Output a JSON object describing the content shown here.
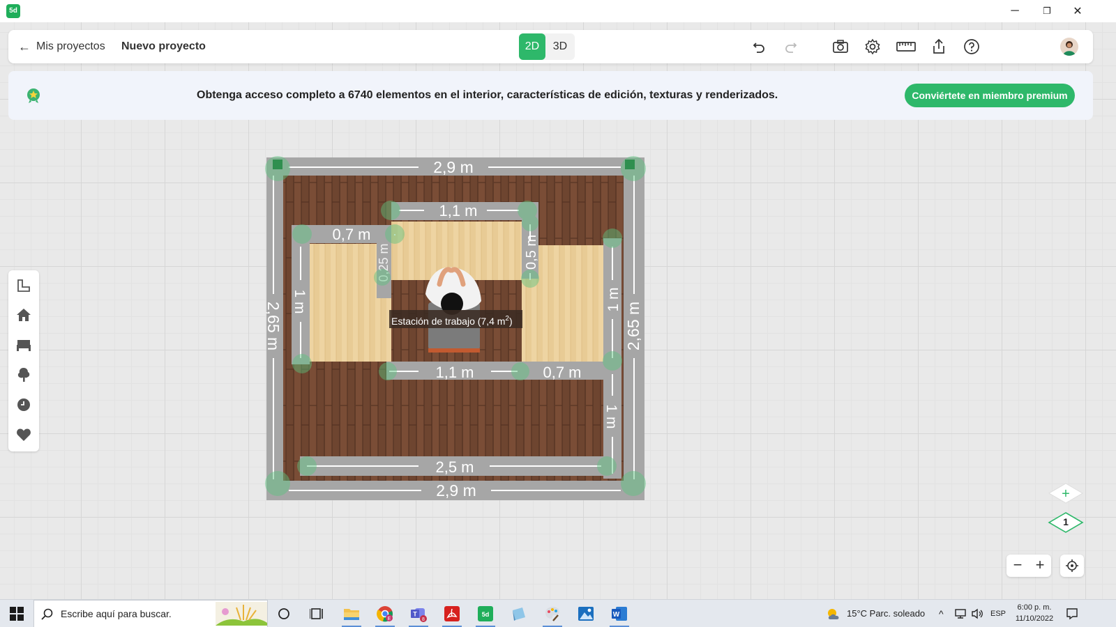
{
  "window": {
    "app_icon_label": "5d",
    "controls": {
      "minimize": "─",
      "restore": "❐",
      "close": "✕"
    }
  },
  "toolbar": {
    "back_label": "Mis proyectos",
    "project_title": "Nuevo proyecto",
    "mode_2d": "2D",
    "mode_3d": "3D",
    "active_mode": "2D",
    "icons": [
      "undo-icon",
      "redo-icon",
      "camera-icon",
      "settings-icon",
      "ruler-icon",
      "share-icon",
      "help-icon"
    ]
  },
  "banner": {
    "text": "Obtenga acceso completo a 6740 elementos en el interior, características de edición, texturas y renderizados.",
    "button_label": "Conviértete en miembro premium"
  },
  "sidebar": {
    "items": [
      {
        "icon": "rooms-icon"
      },
      {
        "icon": "house-icon"
      },
      {
        "icon": "furniture-icon"
      },
      {
        "icon": "tree-icon"
      },
      {
        "icon": "clock-icon"
      },
      {
        "icon": "heart-icon"
      }
    ]
  },
  "plan": {
    "room_label": "Estación de trabajo (7,4 m",
    "room_label_sup": "2",
    "room_label_end": ")",
    "dimensions": {
      "top_outer": "2,9 m",
      "bottom_outer": "2,9 m",
      "left_outer": "2,65 m",
      "right_outer": "2,65 m",
      "inner_top": "1,1 m",
      "inner_left_top": "0,7 m",
      "inner_left_depth": "0,25 m",
      "inner_right_depth": "0,5 m",
      "inner_left_side": "1 m",
      "inner_right_side": "1 m",
      "inner_bottom_mid": "1,1 m",
      "inner_bottom_right": "0,7 m",
      "inner_right_lower": "1 m",
      "inner_bottom_long": "2,5 m"
    }
  },
  "level": {
    "current": "1",
    "add": "+"
  },
  "zoom": {
    "minus": "−",
    "plus": "+"
  },
  "taskbar": {
    "search_placeholder": "Escribe aquí para buscar.",
    "weather": "15°C  Parc. soleado",
    "language": "ESP",
    "time": "6:00 p. m.",
    "date": "11/10/2022",
    "badges": {
      "chrome": "E",
      "teams": "8"
    }
  }
}
